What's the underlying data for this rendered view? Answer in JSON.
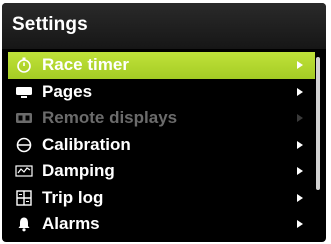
{
  "header": {
    "title": "Settings"
  },
  "menu": {
    "items": [
      {
        "label": "Race timer",
        "icon": "stopwatch-icon",
        "state": "selected"
      },
      {
        "label": "Pages",
        "icon": "pages-icon",
        "state": "normal"
      },
      {
        "label": "Remote displays",
        "icon": "remote-displays-icon",
        "state": "disabled"
      },
      {
        "label": "Calibration",
        "icon": "calibration-icon",
        "state": "normal"
      },
      {
        "label": "Damping",
        "icon": "damping-icon",
        "state": "normal"
      },
      {
        "label": "Trip log",
        "icon": "trip-log-icon",
        "state": "normal"
      },
      {
        "label": "Alarms",
        "icon": "bell-icon",
        "state": "normal"
      }
    ]
  },
  "colors": {
    "highlight": "#b4d830",
    "background": "#000000",
    "text": "#ffffff",
    "disabled_text": "#6b6b6b"
  }
}
